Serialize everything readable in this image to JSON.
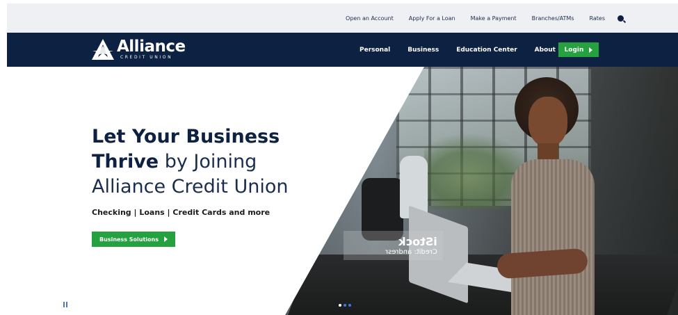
{
  "utility_nav": {
    "items": [
      "Open an Account",
      "Apply For a Loan",
      "Make a Payment",
      "Branches/ATMs",
      "Rates"
    ],
    "search_icon": "search-icon"
  },
  "brand": {
    "name": "Alliance",
    "tagline": "CREDIT UNION",
    "logo_icon": "alliance-star-logo",
    "colors": {
      "navy": "#0d2142",
      "green": "#25a140"
    }
  },
  "main_nav": {
    "items": [
      "Personal",
      "Business",
      "Education Center",
      "About Us"
    ],
    "login_label": "Login"
  },
  "hero": {
    "headline_bold_1": "Let Your Business",
    "headline_bold_2": "Thrive",
    "headline_light_2": " by Joining",
    "headline_light_3": "Alliance Credit Union",
    "subline": "Checking | Loans | Credit Cards and more",
    "cta_label": "Business Solutions",
    "watermark_brand": "iStock",
    "watermark_credit": "Credit: andresr",
    "slides": {
      "count": 3,
      "active": 1
    },
    "pause_icon": "pause-icon"
  }
}
